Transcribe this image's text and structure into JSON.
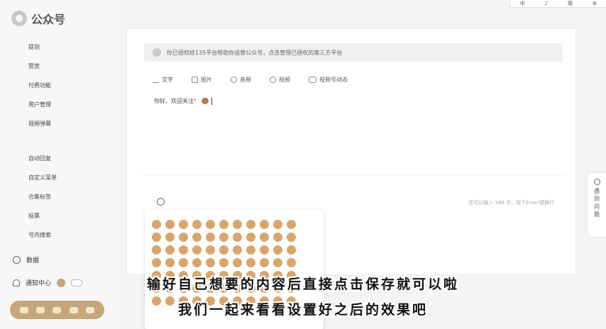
{
  "app": {
    "logo_text": "公众号"
  },
  "ime_bar": {
    "items": [
      "中",
      "♪",
      "简",
      "⚙"
    ]
  },
  "sidebar": {
    "items": [
      "提到",
      "赞赏",
      "付费功能",
      "用户管理",
      "视频弹幕"
    ],
    "items2": [
      "自动回复",
      "自定义菜单",
      "合集标签",
      "投票",
      "号内搜索"
    ],
    "data_label": "数据",
    "notice_label": "通知中心"
  },
  "main": {
    "notice": "你已授权给135平台帮助你运营公众号，点击管理已授权的第三方平台",
    "tabs": [
      {
        "label": "文字",
        "icon": "text-icon"
      },
      {
        "label": "图片",
        "icon": "image-icon"
      },
      {
        "label": "音频",
        "icon": "audio-icon"
      },
      {
        "label": "视频",
        "icon": "video-icon"
      },
      {
        "label": "视频号动态",
        "icon": "channels-icon"
      }
    ],
    "editor_text": "你好，欢迎关注！",
    "count_text": "还可以输入 588 字，按下Enter键换行"
  },
  "help": {
    "chars": [
      "遇",
      "到",
      "问",
      "题"
    ]
  },
  "subtitles": {
    "line1": "输好自己想要的内容后直接点击保存就可以啦",
    "line2": "我们一起来看看设置好之后的效果吧"
  },
  "colors": {
    "accent": "#c8a67b",
    "emoji": "#d8a66c"
  }
}
